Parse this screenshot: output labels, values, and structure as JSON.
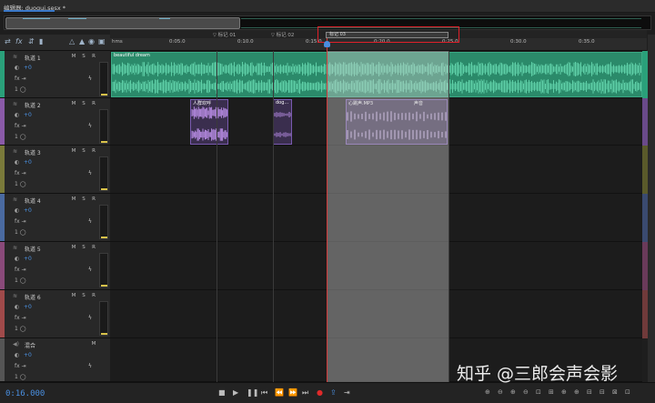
{
  "window": {
    "title": "编辑器: duogui.sesx *"
  },
  "markers": [
    {
      "label": "标记 01"
    },
    {
      "label": "标记 02"
    },
    {
      "label": "标记 03"
    }
  ],
  "ruler": {
    "unit": "hms",
    "labels": [
      "0:05.0",
      "0:10.0",
      "0:15.0",
      "0:20.0",
      "0:25.0",
      "0:30.0",
      "0:35.0"
    ]
  },
  "tracks": [
    {
      "name": "轨道 1",
      "mute": "M",
      "solo": "S",
      "rec": "R",
      "volume": "+0",
      "color": "#2aa07a"
    },
    {
      "name": "轨道 2",
      "mute": "M",
      "solo": "S",
      "rec": "R",
      "volume": "+0",
      "color": "#8a5aa8"
    },
    {
      "name": "轨道 3",
      "mute": "M",
      "solo": "S",
      "rec": "R",
      "volume": "+0",
      "color": "#7a7a3a"
    },
    {
      "name": "轨道 4",
      "mute": "M",
      "solo": "S",
      "rec": "R",
      "volume": "+0",
      "color": "#4a6aa0"
    },
    {
      "name": "轨道 5",
      "mute": "M",
      "solo": "S",
      "rec": "R",
      "volume": "+0",
      "color": "#8a4a7a"
    },
    {
      "name": "轨道 6",
      "mute": "M",
      "solo": "S",
      "rec": "R",
      "volume": "+0",
      "color": "#a04a4a"
    }
  ],
  "mix": {
    "name": "混合",
    "mute": "M",
    "volume": "+0"
  },
  "clips": {
    "track1": "beautiful dream",
    "track2_a": "人群欢呼",
    "track2_b": "dog...",
    "track2_c": "心跳声.MP3",
    "track2_c_suffix": "声音"
  },
  "transport": {
    "time": "0:16.000"
  },
  "watermark": "知乎 @三郎会声会影",
  "colors": {
    "accent": "#4a90e2",
    "clip_green": "#2fa884",
    "clip_purple": "#8a62c0",
    "highlight": "#e0202a"
  }
}
